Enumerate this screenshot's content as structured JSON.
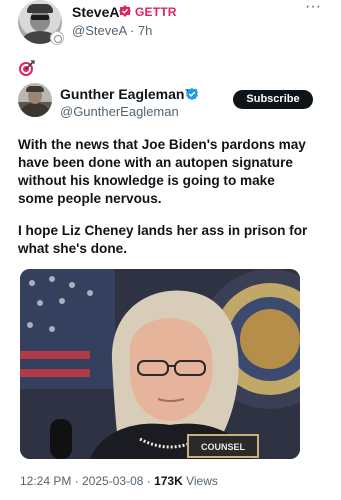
{
  "outer_post": {
    "display_name": "SteveA",
    "platform_label": "GETTR",
    "handle_time": "@SteveA · 7h",
    "more_label": "···",
    "emoji": "🎯"
  },
  "quoted_post": {
    "display_name": "Gunther Eagleman™",
    "handle": "@GuntherEagleman",
    "subscribe_label": "Subscribe",
    "paragraphs": [
      "With the news that Joe Biden's pardons may have been done with an autopen signature without his knowledge is going to make some people nervous.",
      "I hope Liz Cheney lands her ass in prison for what she's done."
    ],
    "photo_placard": "COUNSEL",
    "accent_color": "#1d9bf0"
  },
  "meta": {
    "timestamp": "12:24 PM · 2025-03-08 · ",
    "views_count": "173K",
    "views_label": " Views"
  }
}
